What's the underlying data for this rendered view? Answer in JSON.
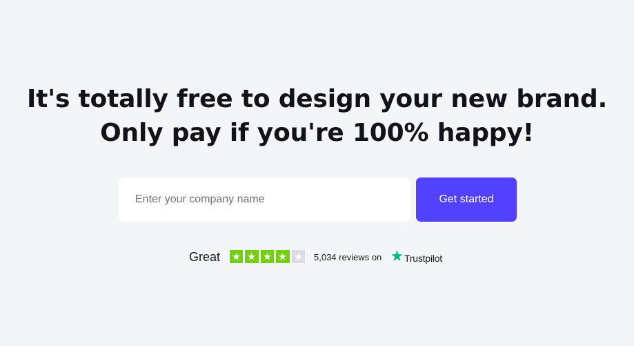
{
  "hero": {
    "headline_line1": "It's totally free to design your new brand.",
    "headline_line2": "Only pay if you're 100% happy!"
  },
  "signup": {
    "placeholder": "Enter your company name",
    "button_label": "Get started",
    "button_color": "#5242ff"
  },
  "rating": {
    "label": "Great",
    "stars_filled": 4,
    "stars_total": 5,
    "star_color": "#73cf11",
    "empty_star_color": "#dcdce6",
    "reviews_text": "5,034 reviews on",
    "platform": "Trustpilot",
    "platform_icon": "trustpilot-star-icon",
    "platform_icon_color": "#00b67a"
  }
}
